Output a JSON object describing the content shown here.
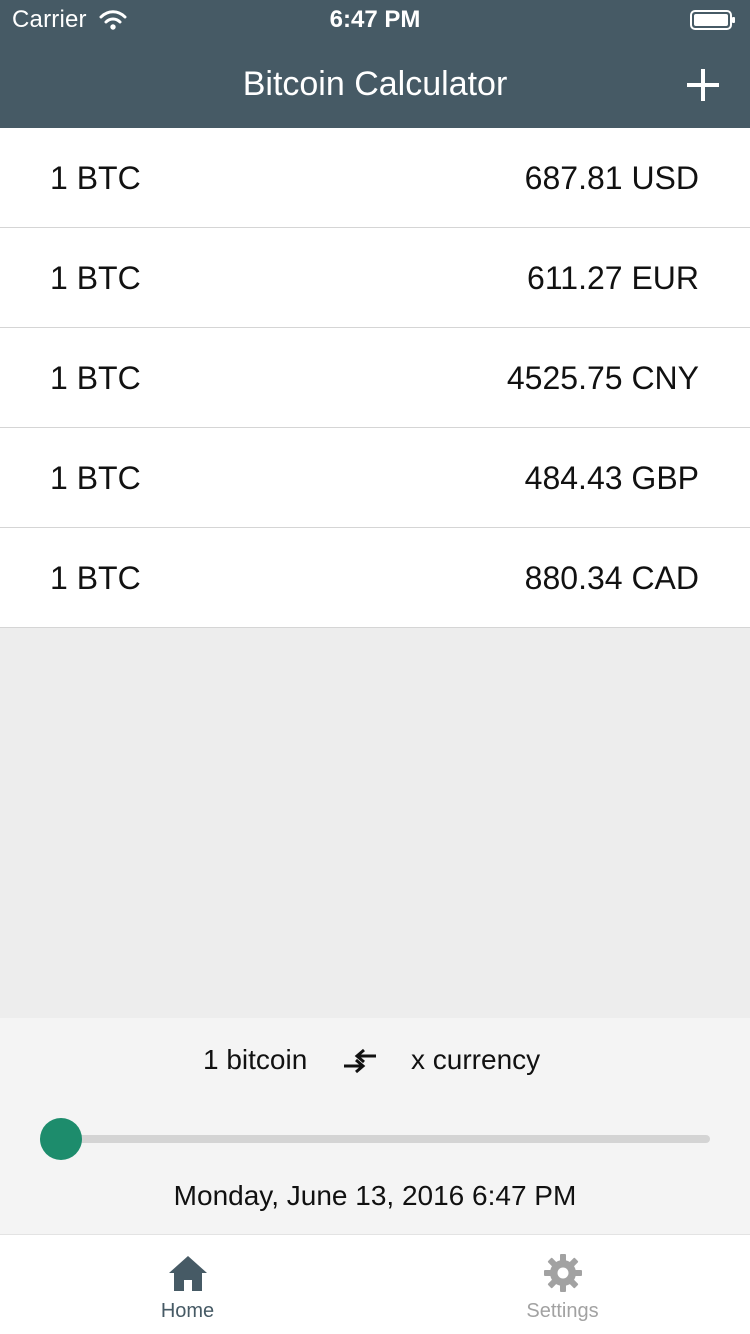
{
  "status_bar": {
    "carrier": "Carrier",
    "time": "6:47 PM",
    "wifi_icon": "wifi-icon",
    "battery_icon": "battery-icon"
  },
  "nav": {
    "title": "Bitcoin Calculator",
    "add_icon": "plus-icon"
  },
  "rates": [
    {
      "left": "1 BTC",
      "right": "687.81 USD"
    },
    {
      "left": "1 BTC",
      "right": "611.27 EUR"
    },
    {
      "left": "1 BTC",
      "right": "4525.75 CNY"
    },
    {
      "left": "1 BTC",
      "right": "484.43 GBP"
    },
    {
      "left": "1 BTC",
      "right": "880.34 CAD"
    }
  ],
  "converter": {
    "from_label": "1 bitcoin",
    "swap_icon": "swap-arrows-icon",
    "to_label": "x currency",
    "slider_fraction": 0,
    "datetime": "Monday, June 13, 2016 6:47 PM"
  },
  "tabs": [
    {
      "label": "Home",
      "icon": "home-icon",
      "active": true
    },
    {
      "label": "Settings",
      "icon": "gear-icon",
      "active": false
    }
  ],
  "colors": {
    "nav_background": "#465a65",
    "accent": "#1d8c6c",
    "active_tab": "#465a65",
    "inactive_tab": "#a2a2a2"
  }
}
